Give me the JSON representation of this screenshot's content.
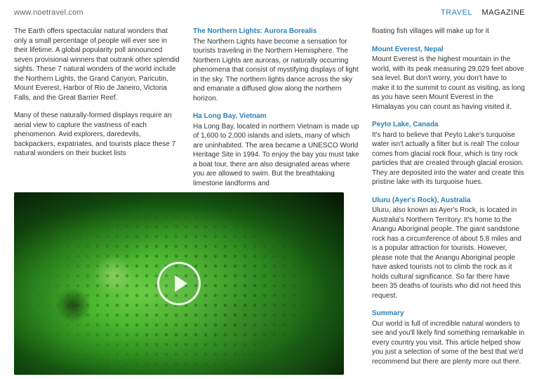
{
  "header": {
    "url": "www.noetravel.com",
    "brand_accent": "TRAVEL",
    "brand_dark": "MAGAZINE"
  },
  "col1": {
    "intro": "The Earth offers spectacular natural wonders that only a small percentage of people will ever see in their lifetime. A global popularity poll announced seven provisional winners that outrank other splendid sights. These 7 natural wonders of the world include the Northern Lights, the Grand Canyon, Paricutin, Mount Everest, Harbor of Rio de Janeiro, Victoria Falls, and the Great Barrier Reef.",
    "intro2": "Many of these naturally-formed displays require an aerial view to capture the vastness of each phenomenon. Avid explorers, daredevils, backpackers, expatriates, and tourists place these 7 natural wonders on their bucket lists"
  },
  "col2": {
    "s1_title": "The Northern Lights: Aurora Borealis",
    "s1_body": "The Northern Lights have become a sensation for tourists traveling in the Northern Hemisphere. The Northern Lights are auroras, or naturally occurring phenomena that consist of mystifying displays of light in the sky. The northern lights dance across the sky and emanate a diffused glow along the northern horizon.",
    "s2_title": "Ha Long Bay, Vietnam",
    "s2_body": "Ha Long Bay, located in northern Vietnam is made up of 1,600 to 2,000 islands and islets, many of which are uninhabited. The area became a UNESCO World Heritage Site in 1994. To enjoy the bay you must take a boat tour, there are also designated areas where you are allowed to swim. But the breathtaking limestone landforms and"
  },
  "col3": {
    "cont": "floating fish villages will make up for it",
    "s1_title": "Mount Everest, Nepal",
    "s1_body": "Mount Everest is the highest mountain in the world, with its peak measuring 29,029 feet above sea level. But don't worry, you don't have to make it to the summit to count as visiting, as long as you have seen Mount Everest in the Himalayas you can count as having visited it.",
    "s2_title": "Peyto Lake, Canada",
    "s2_body": "It's hard to believe that Peyto Lake's turquoise water isn't actually a filter but is real! The colour comes from glacial rock flour, which is tiny rock particles that are created through glacial erosion. They are deposited into the water and create this pristine lake with its turquoise hues.",
    "s3_title": "Uluru (Ayer's Rock), Australia",
    "s3_body": "Uluru, also known as Ayer's Rock, is located in Australia's Northern Territory. It's home to the Anangu Aboriginal people. The giant sandstone rock has a circumference of about 5.8 miles and is a popular attraction for tourists. However, please note that the Anangu Aboriginal people have asked tourists not to climb the rock as it holds cultural significance. So far there have been 35 deaths of tourists who did not heed this request.",
    "s4_title": "Summary",
    "s4_body": "Our world is full of incredible natural wonders to see and you'll likely find something remarkable in every country you visit. This article helped show you just a selection of some of the best that we'd recommend but there are plenty more out there."
  }
}
